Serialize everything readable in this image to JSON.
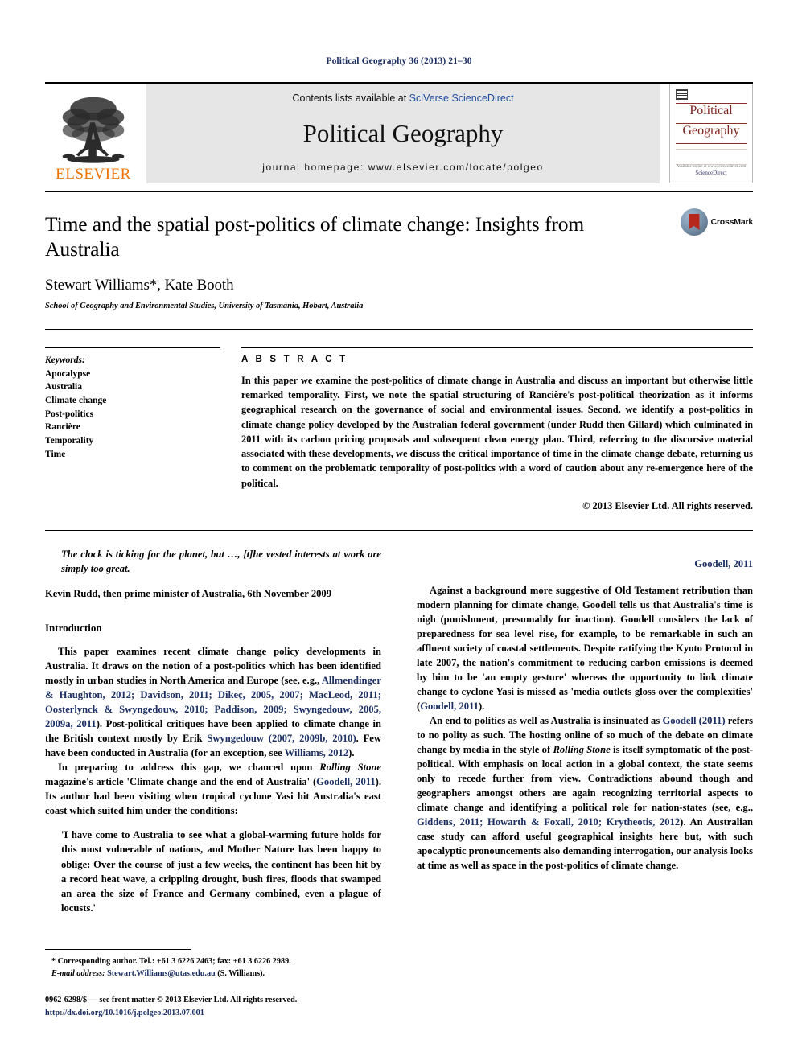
{
  "running_head": "Political Geography 36 (2013) 21–30",
  "masthead": {
    "publisher_name": "ELSEVIER",
    "contents_prefix": "Contents lists available at ",
    "contents_link": "SciVerse ScienceDirect",
    "journal_name": "Political Geography",
    "homepage": "journal homepage: www.elsevier.com/locate/polgeo",
    "cover": {
      "title_line1": "Political",
      "title_line2": "Geography",
      "footer_brand": "ScienceDirect",
      "footer_note": "Available online at www.sciencedirect.com"
    }
  },
  "article": {
    "title": "Time and the spatial post-politics of climate change: Insights from Australia",
    "authors": "Stewart Williams*, Kate Booth",
    "affiliation": "School of Geography and Environmental Studies, University of Tasmania, Hobart, Australia",
    "crossmark_label": "CrossMark"
  },
  "keywords": {
    "heading": "Keywords:",
    "items": [
      "Apocalypse",
      "Australia",
      "Climate change",
      "Post-politics",
      "Rancière",
      "Temporality",
      "Time"
    ]
  },
  "abstract": {
    "heading": "A B S T R A C T",
    "text": "In this paper we examine the post-politics of climate change in Australia and discuss an important but otherwise little remarked temporality. First, we note the spatial structuring of Rancière's post-political theorization as it informs geographical research on the governance of social and environmental issues. Second, we identify a post-politics in climate change policy developed by the Australian federal government (under Rudd then Gillard) which culminated in 2011 with its carbon pricing proposals and subsequent clean energy plan. Third, referring to the discursive material associated with these developments, we discuss the critical importance of time in the climate change debate, returning us to comment on the problematic temporality of post-politics with a word of caution about any re-emergence here of the political.",
    "copyright": "© 2013 Elsevier Ltd. All rights reserved."
  },
  "body": {
    "epigraph": "The clock is ticking for the planet, but …, [t]he vested interests at work are simply too great.",
    "epigraph_attribution": "Kevin Rudd, then prime minister of Australia, 6th November 2009",
    "intro_heading": "Introduction",
    "para1": {
      "s1": "This paper examines recent climate change policy developments in Australia. It draws on the notion of a post-politics which has been identified mostly in urban studies in North America and Europe (see, e.g., ",
      "refs1": "Allmendinger & Haughton, 2012; Davidson, 2011; Dikeç, 2005, 2007; MacLeod, 2011; Oosterlynck & Swyngedouw, 2010; Paddison, 2009; Swyngedouw, 2005, 2009a, 2011",
      "s2": "). Post-political critiques have been applied to climate change in the British context mostly by Erik ",
      "refs2": "Swyngedouw (2007, 2009b, 2010)",
      "s3": ". Few have been conducted in Australia (for an exception, see ",
      "refs3": "Williams, 2012",
      "s4": ")."
    },
    "para2": {
      "s1": "In preparing to address this gap, we chanced upon ",
      "em1": "Rolling Stone",
      "s2": " magazine's article 'Climate change and the end of Australia' (",
      "refs1": "Goodell, 2011",
      "s3": "). Its author had been visiting when tropical cyclone Yasi hit Australia's east coast which suited him under the conditions:"
    },
    "quote": "'I have come to Australia to see what a global-warming future holds for this most vulnerable of nations, and Mother Nature has been happy to oblige: Over the course of just a few weeks, the continent has been hit by a record heat wave, a crippling drought, bush fires, floods that swamped an area the size of France and Germany combined, even a plague of locusts.'",
    "quote_citation": "Goodell, 2011",
    "para3": "Against a background more suggestive of Old Testament retribution than modern planning for climate change, Goodell tells us that Australia's time is nigh (punishment, presumably for inaction). Goodell considers the lack of preparedness for sea level rise, for example, to be remarkable in such an affluent society of coastal settlements. Despite ratifying the Kyoto Protocol in late 2007, the nation's commitment to reducing carbon emissions is deemed by him to be 'an empty gesture' whereas the opportunity to link climate change to cyclone Yasi is missed as 'media outlets gloss over the complexities' (",
    "para3_ref": "Goodell, 2011",
    "para3_end": ").",
    "para4": {
      "s1": "An end to politics as well as Australia is insinuated as ",
      "refs1": "Goodell (2011)",
      "s2": " refers to no polity as such. The hosting online of so much of the debate on climate change by media in the style of ",
      "em1": "Rolling Stone",
      "s3": " is itself symptomatic of the post-political. With emphasis on local action in a global context, the state seems only to recede further from view. Contradictions abound though and geographers amongst others are again recognizing territorial aspects to climate change and identifying a political role for nation-states (see, e.g., ",
      "refs2": "Giddens, 2011; Howarth & Foxall, 2010; Krytheotis, 2012",
      "s4": "). An Australian case study can afford useful geographical insights here but, with such apocalyptic pronouncements also demanding interrogation, our analysis looks at time as well as space in the post-politics of climate change."
    }
  },
  "footnotes": {
    "corresponding": "* Corresponding author. Tel.: +61 3 6226 2463; fax: +61 3 6226 2989.",
    "email_label": "E-mail address:",
    "email": "Stewart.Williams@utas.edu.au",
    "email_suffix": " (S. Williams).",
    "front_matter": "0962-6298/$ — see front matter © 2013 Elsevier Ltd. All rights reserved.",
    "doi": "http://dx.doi.org/10.1016/j.polgeo.2013.07.001"
  },
  "colors": {
    "link": "#1b2f63",
    "elsevier_orange": "#ec7404",
    "cover_maroon": "#7d241d",
    "banner_gray": "#e6e6e6"
  }
}
